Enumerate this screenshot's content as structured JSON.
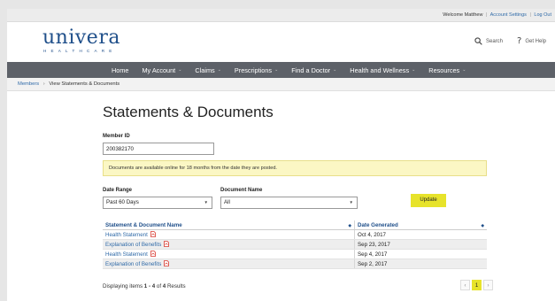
{
  "utility": {
    "welcome": "Welcome Matthew",
    "account_settings": "Account Settings",
    "log_out": "Log Out",
    "separator": "|"
  },
  "header": {
    "logo_word": "univera",
    "logo_sub": "HEALTHCARE",
    "search_label": "Search",
    "help_label": "Get Help"
  },
  "nav": {
    "items": [
      {
        "label": "Home",
        "has_menu": false
      },
      {
        "label": "My Account",
        "has_menu": true
      },
      {
        "label": "Claims",
        "has_menu": true
      },
      {
        "label": "Prescriptions",
        "has_menu": true
      },
      {
        "label": "Find a Doctor",
        "has_menu": true
      },
      {
        "label": "Health and Wellness",
        "has_menu": true
      },
      {
        "label": "Resources",
        "has_menu": true
      }
    ]
  },
  "breadcrumb": {
    "root": "Members",
    "arrow": "›",
    "current": "View Statements & Documents"
  },
  "page": {
    "title": "Statements & Documents",
    "member_id_label": "Member ID",
    "member_id_value": "200382170",
    "notice": "Documents are available online for 18 months from the date they are posted.",
    "date_range_label": "Date Range",
    "date_range_value": "Past 60 Days",
    "document_name_label": "Document Name",
    "document_name_value": "All",
    "update_label": "Update"
  },
  "table": {
    "headers": [
      "Statement & Document Name",
      "Date Generated"
    ],
    "rows": [
      {
        "name": "Health Statement",
        "date": "Oct 4, 2017"
      },
      {
        "name": "Explanation of Benefits",
        "date": "Sep 23, 2017"
      },
      {
        "name": "Health Statement",
        "date": "Sep 4, 2017"
      },
      {
        "name": "Explanation of Benefits",
        "date": "Sep 2, 2017"
      }
    ]
  },
  "footer": {
    "prefix": "Displaying items ",
    "range": "1 - 4",
    "of": " of ",
    "total": "4",
    "suffix": " Results"
  },
  "pager": {
    "prev": "‹",
    "current": "1",
    "next": "›"
  },
  "colors": {
    "brand_blue": "#1f4f8a",
    "nav_bg": "#5d6168",
    "accent_yellow": "#e7e32b",
    "notice_bg": "#fbf7c4",
    "link_blue": "#2f6aa8",
    "pdf_red": "#d9362c"
  },
  "icons": {
    "search": "search-icon",
    "help": "help-icon",
    "pdf": "pdf-icon",
    "sort": "sort-icon",
    "caret": "chevron-down-icon"
  }
}
